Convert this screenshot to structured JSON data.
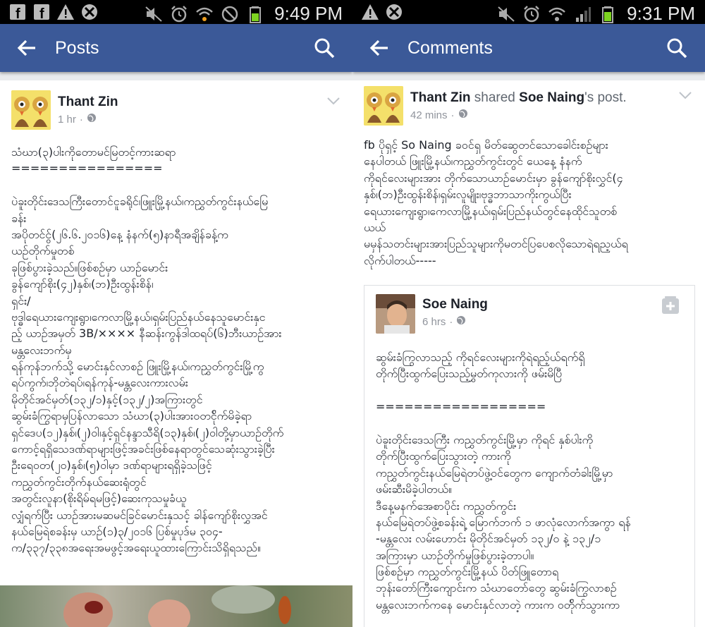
{
  "left": {
    "status_time": "9:49 PM",
    "title": "Posts",
    "author": "Thant Zin",
    "meta_time": "1 hr",
    "body_lines": [
      "သံဃာ(၃)ပါးကိုတောမင်မြတင့်ကားဆရာ",
      "================",
      "",
      "ပဲခူးတိုင်းဒေသကြီးတောင်ငူခရိုင်၊ဖြူးမြို့နယ်၊ကညွှတ်ကွင်းနယ်မြေ",
      "ခန်း",
      "အပိုတင်ငွ်(၂၆.၆.၂၀၁၆)နေ့ နံနက်(၅)နာရီအချိန်ခန့်က",
      "ယဉ်တိုက်မှုတစ်",
      "ခုဖြစ်ပွားခဲ့သည်။ဖြစ်စဉ်မှာ ယာဉ်မောင်း",
      "ခွန်ကျော်စိုး(၄၂)နှစ်၊(ဘ)ဦးထွန်းစိန်၊",
      "ရှင်း/",
      "ဗုဒ္ဓါရေယားကျေးရွာ၊ကေလာမြို့နယ်၊ရှမ်းပြည်နယ်နေသူမောင်းနှင",
      "ည့် ယာဉ်အမှတ် 3B/×××× နီဆန်းကွန်ဒါထရပ်(၆)ဘီးယာဉ်အား",
      "မန္တလေးဘက်မှ",
      "ရန်ကုန်ဘက်သို့ မောင်းနှင်လာစဉ် ဖြူးမြို့နယ်၊ကညွှတ်ကွင်းမြို့ကွ",
      "ရပ်ကွက်၊ဘိုတဲရပ်၊ရန်ကုန်-မန္တလေးကားလမ်း",
      "မိုတိုင်အင်မှတ်(၁၃၂/၁)နှင့်(၁၃၂/၂)အကြားတွင်",
      "ဆွမ်းခံကြွရာမှပြန်လာသော သံဃာ(၃)ပါးအားဝတင်ိုက်မိခဲ့ရာ",
      "ရှင်ဒေပ(၁၂)နှစ်၊(၂)ဝါ၊နှင့်ရှင်နန္ဒာသီရိ(၁၃)နှစ်၊(၂)ဝါတို့မှာယာဉ်တိုက်",
      "ကောင့်ရရှိသေဒဏ်ရာများဖြင့်အခင်းဖြစ်နေရာတွင်သေဆုံးသွားခဲ့ပြီး",
      "ဦးရေဝတ(၂၀)နှစ်၊(၅)ဝါမှာ ဒဏ်ရာများရရှိခဲ့သဖြင့်",
      "ကညွှတ်ကွင်းတိုက်နယ်ဆေးရုံတွင်",
      "အတွင်းလူနာ(စိုးရိမ်ရမဖြင့်)ဆေးကုသမှုခံယူ",
      "လျှံရက်ပြီး ယာဉ်အားမဆမင်ခြင်မောင်းနှသင့် ခါန်ကျော်စိုးလွှအင်",
      "နယ်မြေရဲစခန်းမှ ယာဉ်(၁)၃/၂၀၁၆ ပြစ်မှုပုဒ်မ ၃၀၄-",
      "က/၃၃၇/၃၃၈အရေးအမဖွင့်အရေးယူထားကြောင်းသိရှိရသည်။"
    ]
  },
  "right": {
    "status_time": "9:31 PM",
    "title": "Comments",
    "author": "Thant Zin",
    "shared_word": "shared",
    "shared_owner": "Soe Naing",
    "shared_suffix": "'s post.",
    "meta_time": "42 mins",
    "body_lines": [
      "fb ပိုရှင့် So Naing ခဝင်ရှ မိတ်ဆွေတင်သောခေါင်းစဉ်များ",
      "နေပါတယ် ဖြူးမြို့နယ်၊ကညွှတ်ကွင်းတွင် ယေနေ့ နံနက်",
      "ကိုရင်လေးများအား တိုက်သောယာဉ်မောင်းမှာ ခွန်ကျော်စိုးလွှင်(၄",
      "နှစ်၊(ဘ)ဦးထွန်းစိန်၊ရှမ်းလူမျိုး၊ဗုဒ္ဓဘာသာကိုးကွယ်ပြီး",
      "ရေယားကျေးရွာ၊ကေလာမြို့နယ်၊ရှမ်းပြည်နယ်တွင်နေထိုင်သူတစ်",
      "ယယ်",
      "မမှန်သတင်းများအားပြည်သူများကိုမတင်ပြပေစလိုသောရဲရည့ယ်ရ",
      "လိုက်ပါတယ်-----"
    ],
    "shared": {
      "author": "Soe Naing",
      "meta_time": "6 hrs",
      "body_lines": [
        "ဆွမ်းခံကြွလာသည့် ကိုရင်လေးများကိုရဲရည့်ယ်ရက်ရှိ",
        "တိုက်ပြီးထွက်ပြေးသည့်မွှတ်ကုလားကို ဖမ်းမိပြီ",
        "",
        "==================",
        "",
        "ပဲခူးတိုင်းဒေသကြီး ကညွှတ်ကွင်းမြို့မှာ ကိုရင် နှစ်ပါးကို",
        "တိုက်ပြီးထွက်ပြေးသွားတဲ့ ကားကို",
        "ကညွှတ်ကွင်းနယ်မြေရဲတပ်ဖွဲ့ဝင်တွေက ကျောက်တံခါးမြို့မှာ",
        "ဖမ်းဆီးမိခဲ့ပါတယ်။",
        "ဒီနေ့မနက်အေစာပိုင်း ကညွှတ်ကွင်း",
        "နယ်မြေရဲတပ်ဖွဲ့စခန်းရဲ့ မြောက်ဘက် ၁ ဖာလုံလောက်အကွာ ရန်",
        "-မန္တလေး လမ်းဟောင်း မိုတိုင်အင်မှတ် ၁၃၂/၀ နဲ့ ၁၃၂/၁",
        "အကြားမှာ ယာဉ်တိုက်မှုဖြစ်ပွားခဲ့တာပါ။",
        "ဖြစ်စဉ်မှာ ကညွှတ်ကွင်းမြို့နယ် ပိတ်ဖြူတောရ",
        "ဘုန်းတော်ကြီးကျောင်းက သံဃာတော်တွေ ဆွမ်းခံကြွလာစဉ်",
        "မန္တလေးဘက်ကနေ မောင်းနှင်လာတဲ့ ကားက ဝတ်ိုက်သွားကာ"
      ]
    }
  }
}
